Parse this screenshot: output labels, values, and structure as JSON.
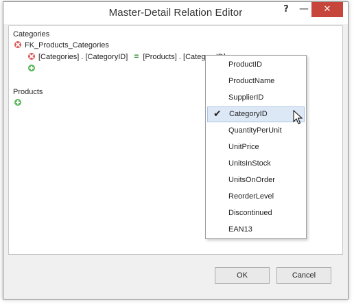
{
  "window": {
    "title": "Master-Detail Relation Editor",
    "help_glyph": "?",
    "minimize_glyph": "—",
    "close_glyph": "✕"
  },
  "tree": {
    "master_table": "Categories",
    "relation_name": "FK_Products_Categories",
    "condition": {
      "left_table": "[Categories]",
      "dot": ".",
      "left_column": "[CategoryID]",
      "operator": "=",
      "right_table": "[Products]",
      "right_column": "[CategoryID]"
    },
    "detail_table": "Products"
  },
  "column_dropdown": {
    "items": [
      {
        "label": "ProductID",
        "selected": false
      },
      {
        "label": "ProductName",
        "selected": false
      },
      {
        "label": "SupplierID",
        "selected": false
      },
      {
        "label": "CategoryID",
        "selected": true
      },
      {
        "label": "QuantityPerUnit",
        "selected": false
      },
      {
        "label": "UnitPrice",
        "selected": false
      },
      {
        "label": "UnitsInStock",
        "selected": false
      },
      {
        "label": "UnitsOnOrder",
        "selected": false
      },
      {
        "label": "ReorderLevel",
        "selected": false
      },
      {
        "label": "Discontinued",
        "selected": false
      },
      {
        "label": "EAN13",
        "selected": false
      }
    ],
    "check_glyph": "✔"
  },
  "buttons": {
    "ok": "OK",
    "cancel": "Cancel"
  },
  "colors": {
    "close_button": "#c7463c",
    "remove_icon": "#d9534f",
    "add_icon": "#5cb85c",
    "equals_sign": "#2e8b2e",
    "selected_item_bg": "#dce8f5"
  },
  "icons": {
    "remove": "remove-icon",
    "add": "add-icon",
    "cursor": "mouse-pointer-icon"
  }
}
